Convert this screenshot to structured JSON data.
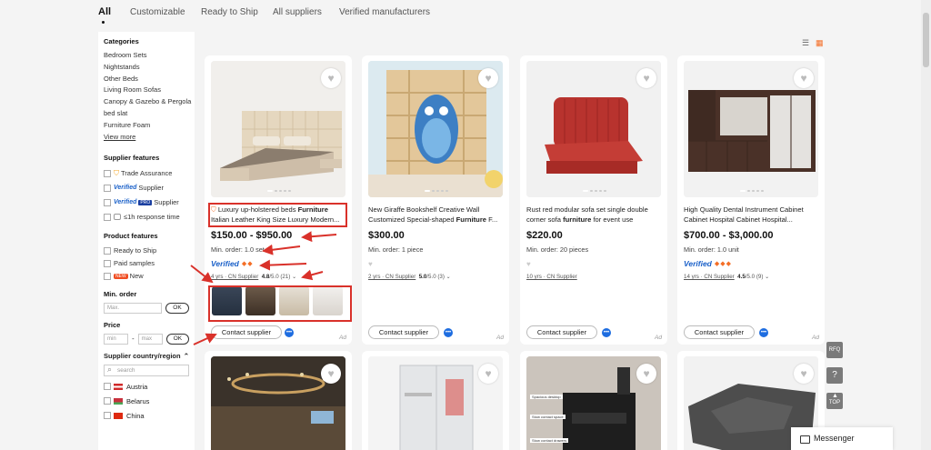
{
  "tabs": [
    "All",
    "Customizable",
    "Ready to Ship",
    "All suppliers",
    "Verified manufacturers"
  ],
  "sidebar": {
    "categories_title": "Categories",
    "categories": [
      "Bedroom Sets",
      "Nightstands",
      "Other Beds",
      "Living Room Sofas",
      "Canopy & Gazebo & Pergola",
      "bed slat",
      "Furniture Foam"
    ],
    "view_more": "View more",
    "supplier_features_title": "Supplier features",
    "trade_assurance": "Trade Assurance",
    "verified_word": "Verified",
    "supplier_word": "Supplier",
    "pro_tag": "PRO",
    "response_time": "≤1h response time",
    "product_features_title": "Product features",
    "ready_to_ship": "Ready to Ship",
    "paid_samples": "Paid samples",
    "new_tag": "NEW",
    "new_label": "New",
    "min_order_title": "Min. order",
    "min_placeholder": "Max.",
    "ok": "OK",
    "price_title": "Price",
    "price_min": "min",
    "price_sep": "-",
    "price_max": "max",
    "country_title": "Supplier country/region",
    "search_placeholder": "search",
    "countries": [
      "Austria",
      "Belarus",
      "China"
    ]
  },
  "products": [
    {
      "title_pre": "Luxury up-holstered beds ",
      "title_bold": "Furniture",
      "title_post": " Italian Leather King Size Luxury Modern...",
      "price": "$150.00 - $950.00",
      "min_order": "Min. order: 1.0 set",
      "verified": "Verified",
      "years": "4 yrs · CN Supplier",
      "rating": "4.8",
      "rating_of": "/5.0 (21)",
      "contact": "Contact supplier",
      "ad": "Ad"
    },
    {
      "title_pre": "New Giraffe Bookshelf Creative Wall Customized Special-shaped ",
      "title_bold": "Furniture",
      "title_post": " F...",
      "price": "$300.00",
      "min_order": "Min. order: 1 piece",
      "verified": "",
      "years": "2 yrs · CN Supplier",
      "rating": "5.0",
      "rating_of": "/5.0 (3)",
      "contact": "Contact supplier",
      "ad": "Ad"
    },
    {
      "title_pre": "Rust red modular sofa set single double corner sofa ",
      "title_bold": "furniture",
      "title_post": " for event use",
      "price": "$220.00",
      "min_order": "Min. order: 20 pieces",
      "verified": "",
      "years": "10 yrs · CN Supplier",
      "rating": "",
      "rating_of": "",
      "contact": "Contact supplier",
      "ad": "Ad"
    },
    {
      "title_pre": "High Quality Dental Instrument Cabinet Cabinet Hospital Cabinet Hospital...",
      "title_bold": "",
      "title_post": "",
      "price": "$700.00 - $3,000.00",
      "min_order": "Min. order: 1.0 unit",
      "verified": "Verified",
      "years": "14 yrs · CN Supplier",
      "rating": "4.5",
      "rating_of": "/5.0 (9)",
      "contact": "Contact supplier",
      "ad": "Ad"
    }
  ],
  "row2_labels": [
    "Spacious desktop",
    "Stow contact space",
    "Stow contact drawers"
  ],
  "floating": {
    "rfq": "RFQ",
    "help": "?",
    "top": "TOP",
    "messenger": "Messenger"
  },
  "colors": {
    "accent": "#f46e26",
    "verified_blue": "#1b61c9",
    "highlight_red": "#d9312a"
  }
}
